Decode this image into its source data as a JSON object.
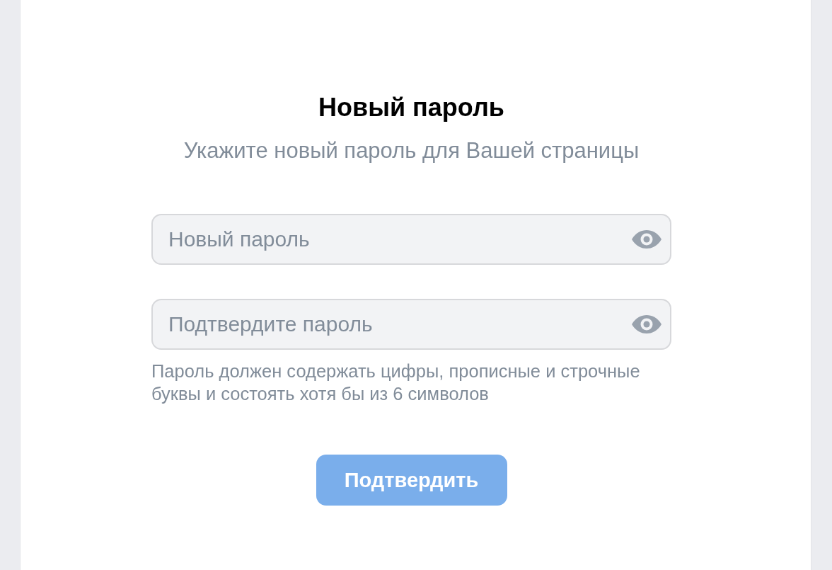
{
  "form": {
    "title": "Новый пароль",
    "subtitle": "Укажите новый пароль для Вашей страницы",
    "fields": [
      {
        "placeholder": "Новый пароль"
      },
      {
        "placeholder": "Подтвердите пароль"
      }
    ],
    "hint": "Пароль должен содержать цифры, прописные и строчные буквы и состоять хотя бы из 6 символов",
    "submit_button": {
      "label": "Подтвердить",
      "disabled": true
    }
  }
}
